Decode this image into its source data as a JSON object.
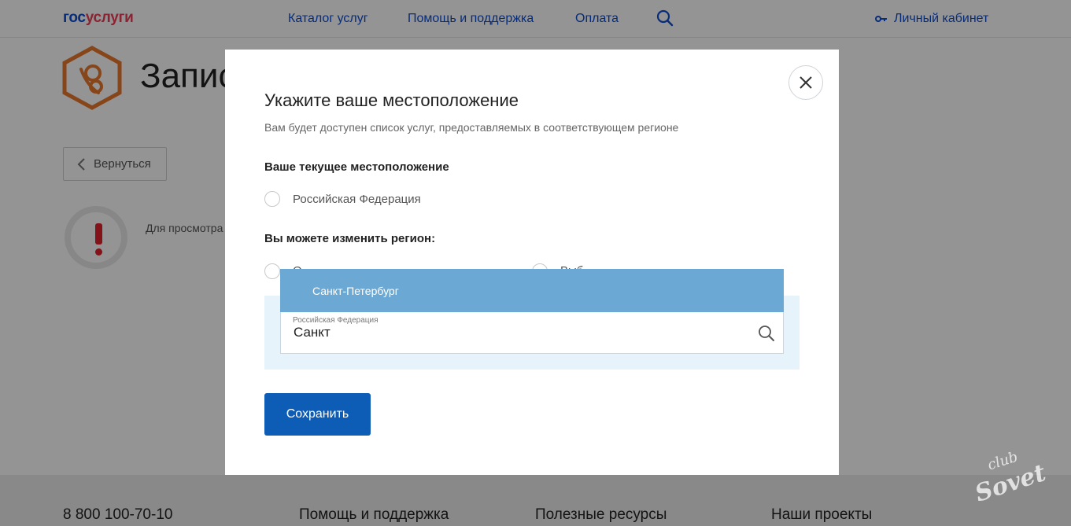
{
  "header": {
    "logo_part1": "гос",
    "logo_part2": "услуги",
    "nav": [
      "Каталог услуг",
      "Помощь и поддержка",
      "Оплата"
    ],
    "cabinet_label": "Личный кабинет"
  },
  "background": {
    "page_title": "Запис",
    "back_label": "Вернуться",
    "note_text": "Для просмотра"
  },
  "footer": {
    "phone": "8 800 100-70-10",
    "help": "Помощь и поддержка",
    "resources": "Полезные ресурсы",
    "projects": "Наши проекты"
  },
  "modal": {
    "title": "Укажите ваше местоположение",
    "subtitle": "Вам будет доступен список услуг, предоставляемых в соответствующем регионе",
    "current_label": "Ваше текущее местоположение",
    "current_option": "Российская Федерация",
    "change_label": "Вы можете изменить регион:",
    "change_option_a": "О",
    "change_option_b": "Выб",
    "suggestion": "Санкт-Петербург",
    "input_caption": "Российская Федерация",
    "input_value": "Санкт",
    "save_label": "Сохранить"
  },
  "watermark_text": "club Sovet",
  "colors": {
    "brand_blue": "#0d4cd3",
    "brand_red": "#ee3f58",
    "button_blue": "#0d5cb6",
    "suggestion_blue": "#6ba9d4",
    "warning_red": "#e3212b",
    "hex_orange": "#e8772e"
  },
  "icons": {
    "search": "search-icon",
    "key": "key-icon",
    "close": "close-icon",
    "back": "chevron-left-icon",
    "warning": "exclamation-icon",
    "pacifier": "pacifier-icon"
  }
}
